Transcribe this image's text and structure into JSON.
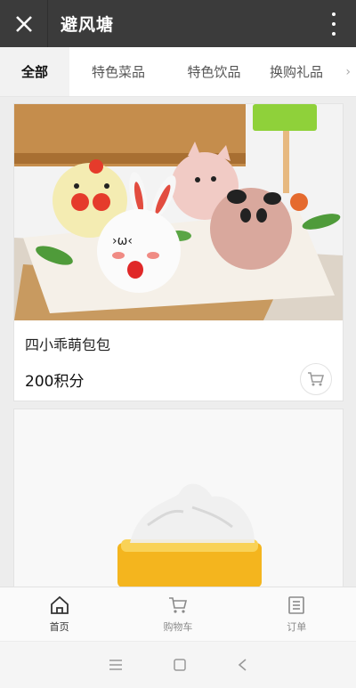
{
  "header": {
    "title": "避风塘",
    "close_icon": "close-icon",
    "more_icon": "more-vertical-icon"
  },
  "tabs": [
    {
      "label": "全部",
      "active": true
    },
    {
      "label": "特色菜品",
      "active": false
    },
    {
      "label": "特色饮品",
      "active": false
    },
    {
      "label": "换购礼品",
      "active": false
    }
  ],
  "products": [
    {
      "name": "四小乖萌包包",
      "price": "200积分",
      "image": "steamed-buns-photo",
      "cart_icon": "cart-icon"
    },
    {
      "name": "",
      "price": "",
      "image": "drink-jelly-photo"
    }
  ],
  "bottom_nav": [
    {
      "label": "首页",
      "icon": "home-icon",
      "active": true
    },
    {
      "label": "购物车",
      "icon": "cart-icon",
      "active": false
    },
    {
      "label": "订单",
      "icon": "orders-icon",
      "active": false
    }
  ],
  "system_bar": {
    "icons": [
      "menu-icon",
      "home-square-icon",
      "back-icon"
    ]
  },
  "colors": {
    "header_bg": "#3b3b3b",
    "page_bg": "#ededed",
    "tab_active_bg": "#f2f2f2"
  }
}
